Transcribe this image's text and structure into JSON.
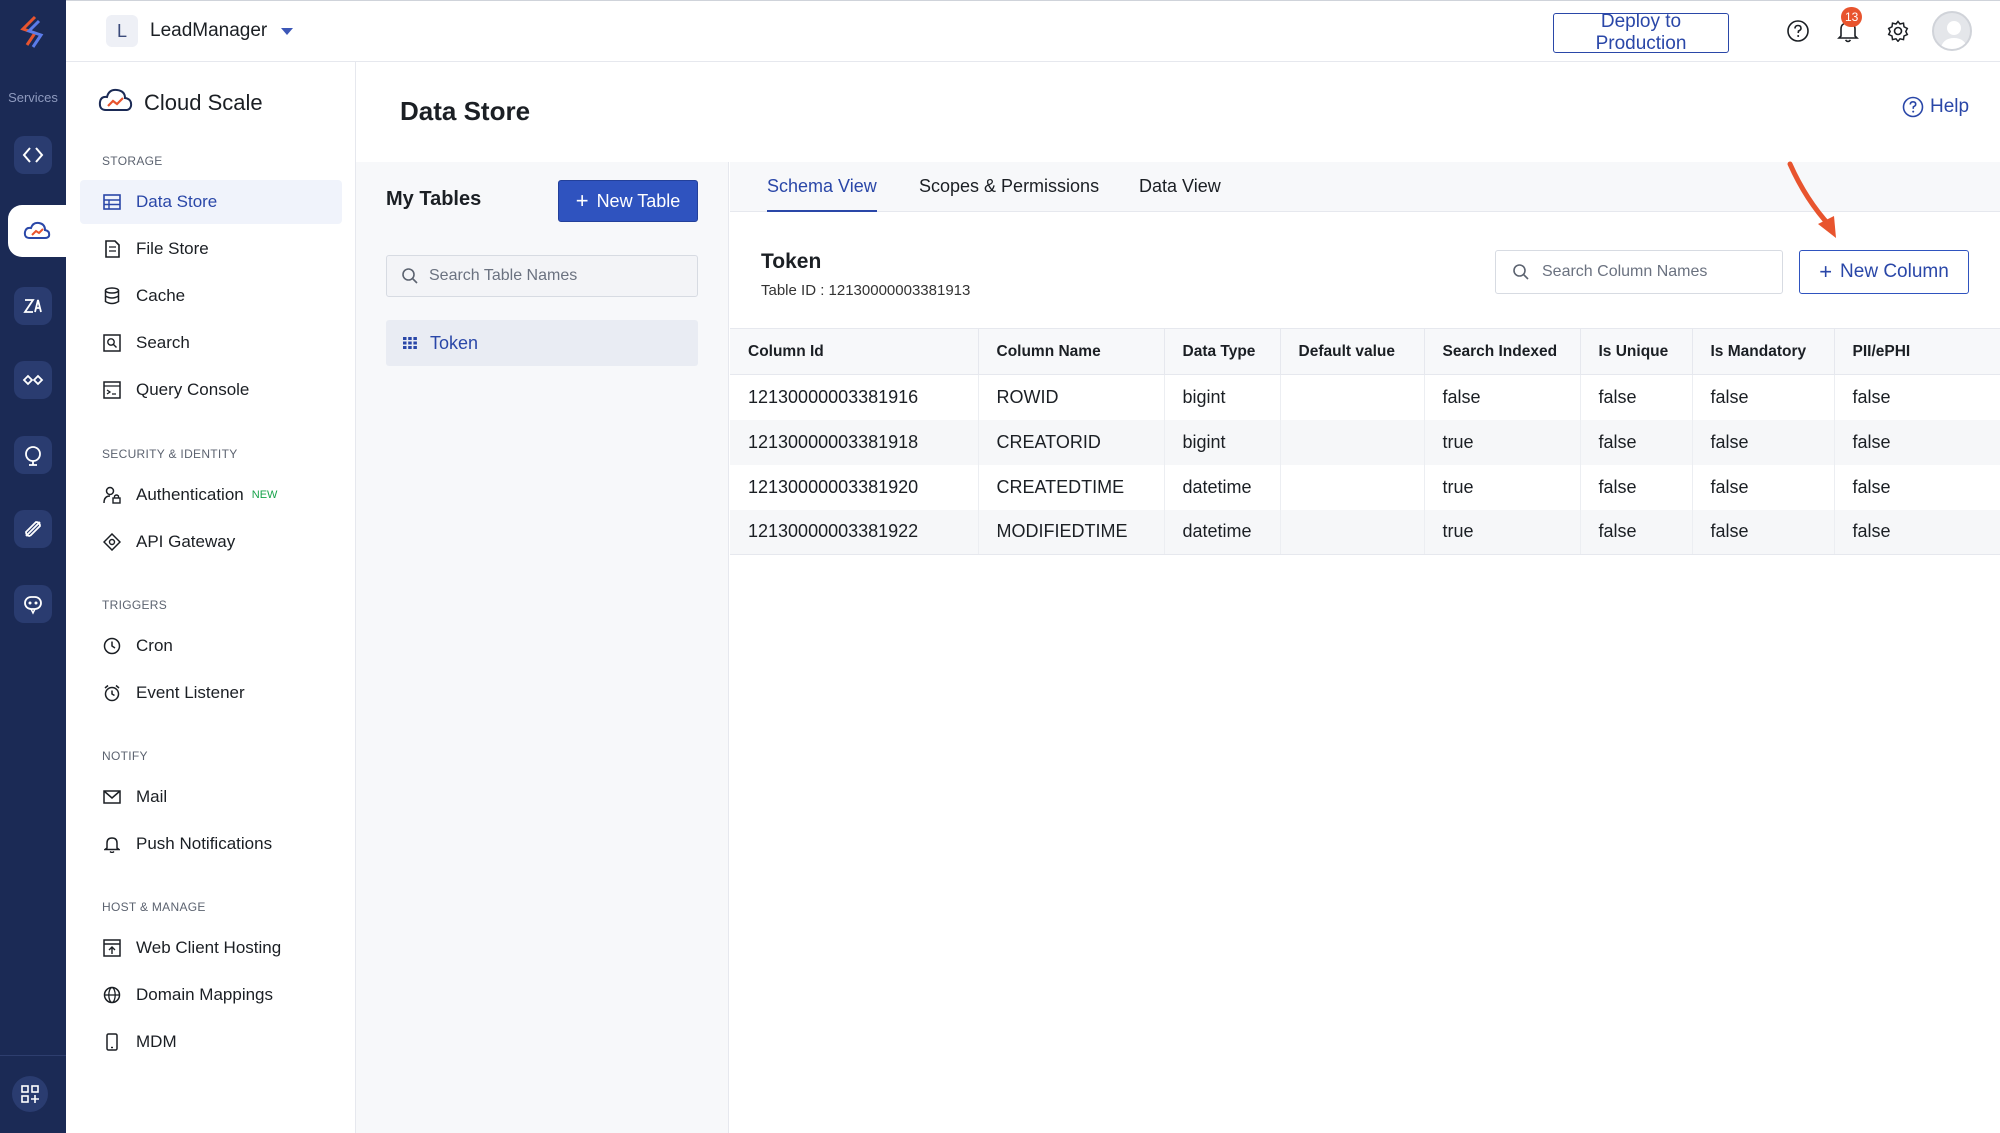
{
  "rail": {
    "services_label": "Services"
  },
  "topbar": {
    "project_initial": "L",
    "project_name": "LeadManager",
    "deploy_label": "Deploy to Production",
    "notification_count": "13"
  },
  "sidebar": {
    "title": "Cloud Scale",
    "sections": [
      {
        "label": "STORAGE",
        "items": [
          "Data Store",
          "File Store",
          "Cache",
          "Search",
          "Query Console"
        ]
      },
      {
        "label": "SECURITY & IDENTITY",
        "items": [
          "Authentication",
          "API Gateway"
        ]
      },
      {
        "label": "TRIGGERS",
        "items": [
          "Cron",
          "Event Listener"
        ]
      },
      {
        "label": "NOTIFY",
        "items": [
          "Mail",
          "Push Notifications"
        ]
      },
      {
        "label": "HOST & MANAGE",
        "items": [
          "Web Client Hosting",
          "Domain Mappings",
          "MDM"
        ]
      }
    ],
    "new_tag": "NEW"
  },
  "page": {
    "title": "Data Store",
    "help_label": "Help"
  },
  "tables_panel": {
    "heading": "My Tables",
    "new_table_label": "New Table",
    "search_placeholder": "Search Table Names",
    "items": [
      "Token"
    ]
  },
  "main": {
    "tabs": [
      "Schema View",
      "Scopes & Permissions",
      "Data View"
    ],
    "table_name": "Token",
    "table_id": "Table ID : 12130000003381913",
    "column_search_placeholder": "Search Column Names",
    "new_column_label": "New Column",
    "columns": [
      "Column Id",
      "Column Name",
      "Data Type",
      "Default value",
      "Search Indexed",
      "Is Unique",
      "Is Mandatory",
      "PII/ePHI"
    ],
    "rows": [
      [
        "12130000003381916",
        "ROWID",
        "bigint",
        "",
        "false",
        "false",
        "false",
        "false"
      ],
      [
        "12130000003381918",
        "CREATORID",
        "bigint",
        "",
        "true",
        "false",
        "false",
        "false"
      ],
      [
        "12130000003381920",
        "CREATEDTIME",
        "datetime",
        "",
        "true",
        "false",
        "false",
        "false"
      ],
      [
        "12130000003381922",
        "MODIFIEDTIME",
        "datetime",
        "",
        "true",
        "false",
        "false",
        "false"
      ]
    ]
  },
  "colors": {
    "accent": "#2a47a8",
    "rail": "#1b2a55",
    "button": "#2f53bf",
    "annotation_arrow": "#e8542e"
  }
}
